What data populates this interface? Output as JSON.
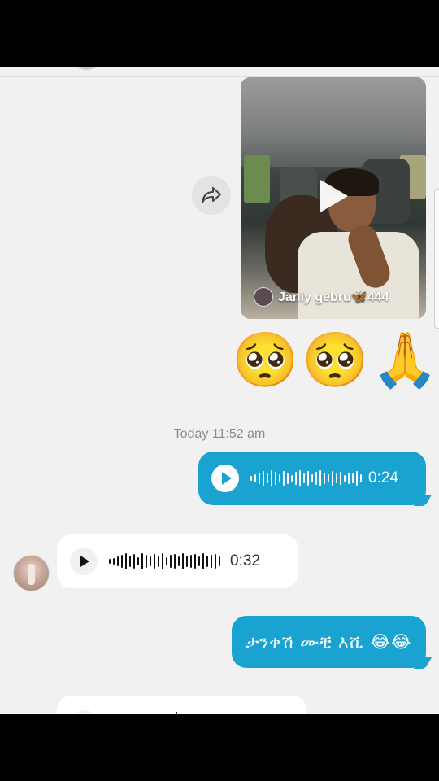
{
  "video": {
    "caption": "Janiy gebru🦋444",
    "icons": [
      "share-arrow-icon",
      "play-icon"
    ]
  },
  "reactions": {
    "emojis": [
      "🥺",
      "🥺",
      "🙏"
    ]
  },
  "timestamp": "Today 11:52 am",
  "messages": [
    {
      "type": "voice",
      "direction": "outgoing",
      "duration": "0:24"
    },
    {
      "type": "voice",
      "direction": "incoming",
      "duration": "0:32"
    },
    {
      "type": "text",
      "direction": "outgoing",
      "text": "ታንቀሽ ሙቺ እሺ 😂😂"
    }
  ],
  "colors": {
    "outgoing_bubble": "#1aa3d1",
    "incoming_bubble": "#ffffff",
    "background": "#f1f1f2"
  }
}
